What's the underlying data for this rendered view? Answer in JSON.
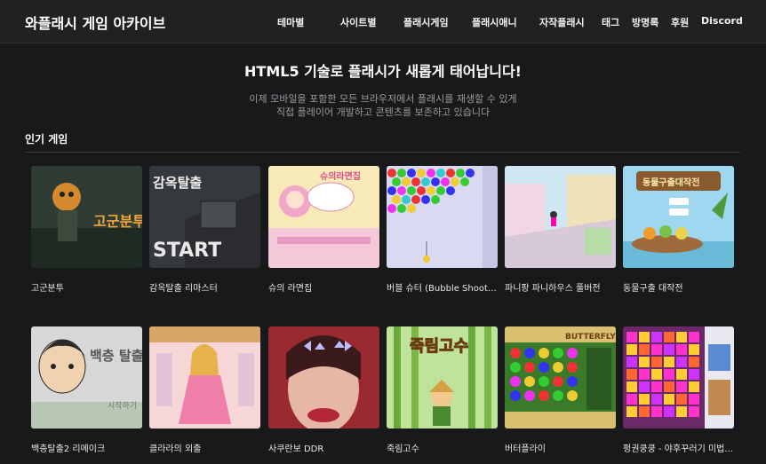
{
  "header": {
    "brand": "와플래시 게임 아카이브",
    "nav": [
      "테마별",
      "사이트별",
      "플래시게임",
      "플래시애니",
      "자작플래시",
      "태그",
      "방명록",
      "후원",
      "Discord"
    ]
  },
  "hero": {
    "title": "HTML5 기술로 플래시가 새롭게 태어납니다!",
    "line1": "이제 모바일을 포함한 모든 브라우저에서 플래시를 재생할 수 있게",
    "line2": "직접 플레이어 개발하고 콘텐츠를 보존하고 있습니다"
  },
  "section": {
    "title": "인기 게임"
  },
  "games": [
    {
      "title": "고군분투",
      "thumb_text": "고군분투"
    },
    {
      "title": "감옥탈출 리마스터",
      "thumb_text": "감옥탈출"
    },
    {
      "title": "슈의 라면집",
      "thumb_text": "슈의라면집"
    },
    {
      "title": "버블 슈터 (Bubble Shooter)",
      "thumb_text": ""
    },
    {
      "title": "파니팡 파니하우스 풀버전",
      "thumb_text": ""
    },
    {
      "title": "동물구출 대작전",
      "thumb_text": "동물구출대작전"
    },
    {
      "title": "백층탈출2 리메이크",
      "thumb_text": "백층 탈출2"
    },
    {
      "title": "클라라의 외출",
      "thumb_text": ""
    },
    {
      "title": "사쿠란보 DDR",
      "thumb_text": ""
    },
    {
      "title": "죽림고수",
      "thumb_text": "죽림고수"
    },
    {
      "title": "버터플라이",
      "thumb_text": "BUTTERFLY"
    },
    {
      "title": "펑권쿵쿵 - 야후꾸러기 미법...",
      "thumb_text": ""
    }
  ]
}
